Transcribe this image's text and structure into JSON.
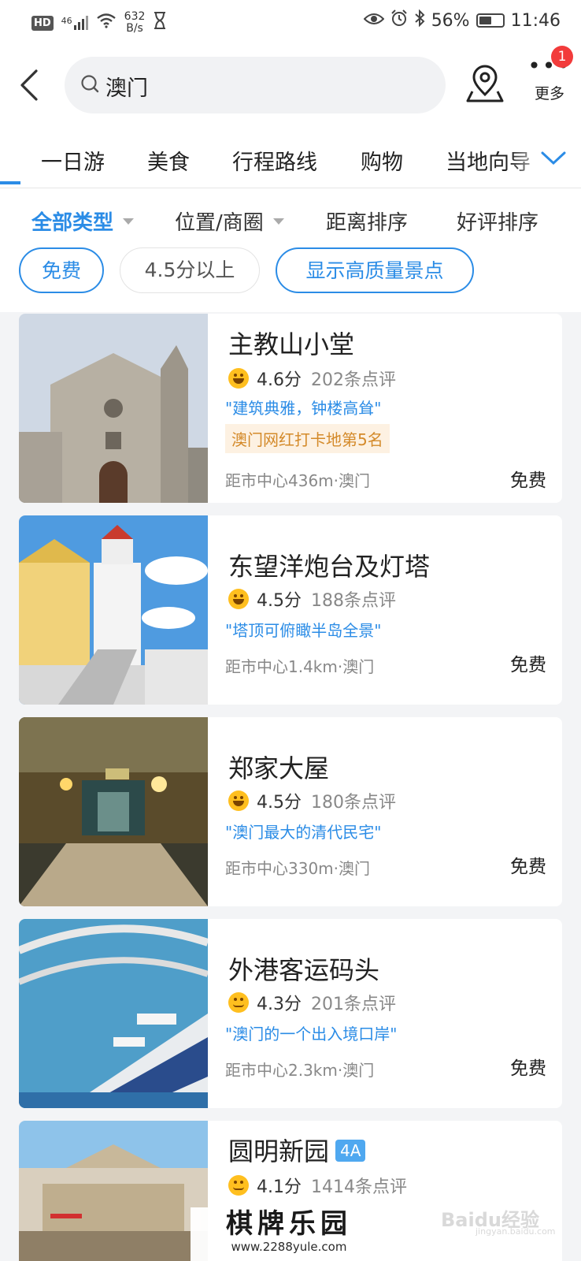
{
  "status_bar": {
    "hd": "HD",
    "signal": "46",
    "net_speed_value": "632",
    "net_speed_unit": "B/s",
    "battery": "56%",
    "battery_level": 0.56,
    "time": "11:46"
  },
  "header": {
    "search_query": "澳门",
    "more_label": "更多",
    "more_badge": "1"
  },
  "tabs": [
    {
      "label": "一日游"
    },
    {
      "label": "美食"
    },
    {
      "label": "行程路线"
    },
    {
      "label": "购物"
    },
    {
      "label": "当地向导"
    }
  ],
  "filters": [
    {
      "label": "全部类型",
      "active": true
    },
    {
      "label": "位置/商圈",
      "active": false
    },
    {
      "label": "距离排序",
      "active": false
    },
    {
      "label": "好评排序",
      "active": false
    }
  ],
  "chips": [
    {
      "label": "免费",
      "selected": true
    },
    {
      "label": "4.5分以上",
      "selected": false
    },
    {
      "label": "显示高质量景点",
      "selected": true
    }
  ],
  "listings": [
    {
      "name": "主教山小堂",
      "score": "4.6分",
      "reviews": "202条点评",
      "quote": "\"建筑典雅，钟楼高耸\"",
      "rank": "澳门网红打卡地第5名",
      "distance": "距市中心436m·澳门",
      "price": "免费"
    },
    {
      "name": "东望洋炮台及灯塔",
      "score": "4.5分",
      "reviews": "188条点评",
      "quote": "\"塔顶可俯瞰半岛全景\"",
      "distance": "距市中心1.4km·澳门",
      "price": "免费"
    },
    {
      "name": "郑家大屋",
      "score": "4.5分",
      "reviews": "180条点评",
      "quote": "\"澳门最大的清代民宅\"",
      "distance": "距市中心330m·澳门",
      "price": "免费"
    },
    {
      "name": "外港客运码头",
      "score": "4.3分",
      "reviews": "201条点评",
      "quote": "\"澳门的一个出入境口岸\"",
      "distance": "距市中心2.3km·澳门",
      "price": "免费"
    },
    {
      "name": "圆明新园",
      "badge": "4A",
      "score": "4.1分",
      "reviews": "1414条点评"
    }
  ],
  "watermark": {
    "title": "棋牌乐园",
    "url": "www.2288yule.com",
    "baidu": "Baidu经验",
    "baidu_url": "jingyan.baidu.com"
  },
  "colors": {
    "accent": "#2b8ce6",
    "badge": "#f23b3b",
    "rank_text": "#d48a2a"
  }
}
